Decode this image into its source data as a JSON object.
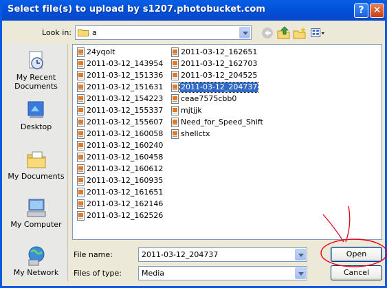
{
  "window": {
    "title": "Select file(s) to upload by s1207.photobucket.com",
    "help_glyph": "?",
    "close_glyph": "✕"
  },
  "toolbar": {
    "lookin_label": "Look in:",
    "lookin_value": "a"
  },
  "places": [
    {
      "label": "My Recent Documents",
      "icon": "recent-documents-icon"
    },
    {
      "label": "Desktop",
      "icon": "desktop-icon"
    },
    {
      "label": "My Documents",
      "icon": "my-documents-icon"
    },
    {
      "label": "My Computer",
      "icon": "my-computer-icon"
    },
    {
      "label": "My Network",
      "icon": "my-network-icon"
    }
  ],
  "files_col1": [
    "24yqolt",
    "2011-03-12_143954",
    "2011-03-12_151336",
    "2011-03-12_151631",
    "2011-03-12_154223",
    "2011-03-12_155337",
    "2011-03-12_155607",
    "2011-03-12_160058",
    "2011-03-12_160240",
    "2011-03-12_160458",
    "2011-03-12_160612",
    "2011-03-12_160935",
    "2011-03-12_161651",
    "2011-03-12_162146",
    "2011-03-12_162526"
  ],
  "files_col2": [
    "2011-03-12_162651",
    "2011-03-12_162703",
    "2011-03-12_204525",
    "2011-03-12_204737",
    "ceae7575cbb0",
    "mjtjjk",
    "Need_for_Speed_Shift",
    "shellctx"
  ],
  "selected_file": "2011-03-12_204737",
  "fields": {
    "file_name_label": "File name:",
    "file_name_value": "2011-03-12_204737",
    "file_type_label": "Files of type:",
    "file_type_value": "Media"
  },
  "buttons": {
    "open": "Open",
    "cancel": "Cancel"
  },
  "colors": {
    "title_bar": "#0A58E6",
    "selection": "#316AC5",
    "annotation": "#E0001B",
    "dialog_bg": "#ECE9D8"
  }
}
